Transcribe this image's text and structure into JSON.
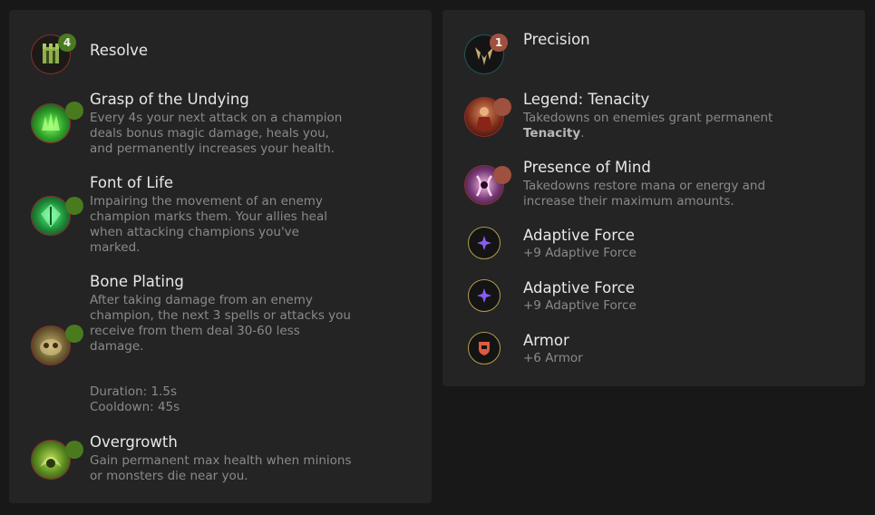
{
  "primary": {
    "tree": {
      "name": "Resolve",
      "badge": "4"
    },
    "runes": [
      {
        "name": "Grasp of the Undying",
        "desc": "Every 4s your next attack on a champion deals bonus magic damage, heals you, and permanently increases your health."
      },
      {
        "name": "Font of Life",
        "desc": "Impairing the movement of an enemy champion marks them. Your allies heal when attacking champions you've marked."
      },
      {
        "name": "Bone Plating",
        "desc": "After taking damage from an enemy champion, the next 3 spells or attacks you receive from them deal 30-60 less damage.",
        "extra1": "Duration: 1.5s",
        "extra2": "Cooldown: 45s"
      },
      {
        "name": "Overgrowth",
        "desc": "Gain permanent max health when minions or monsters die near you."
      }
    ],
    "accent": "#4a7a1e"
  },
  "secondary": {
    "tree": {
      "name": "Precision",
      "badge": "1"
    },
    "runes": [
      {
        "name": "Legend: Tenacity",
        "desc_pre": "Takedowns on enemies grant permanent ",
        "desc_bold": "Tenacity",
        "desc_post": "."
      },
      {
        "name": "Presence of Mind",
        "desc": "Takedowns restore mana or energy and increase their maximum amounts."
      }
    ],
    "accent": "#a0503e"
  },
  "shards": [
    {
      "name": "Adaptive Force",
      "desc": "+9 Adaptive Force",
      "icon": "adaptive-force-icon"
    },
    {
      "name": "Adaptive Force",
      "desc": "+9 Adaptive Force",
      "icon": "adaptive-force-icon"
    },
    {
      "name": "Armor",
      "desc": "+6 Armor",
      "icon": "armor-icon"
    }
  ]
}
